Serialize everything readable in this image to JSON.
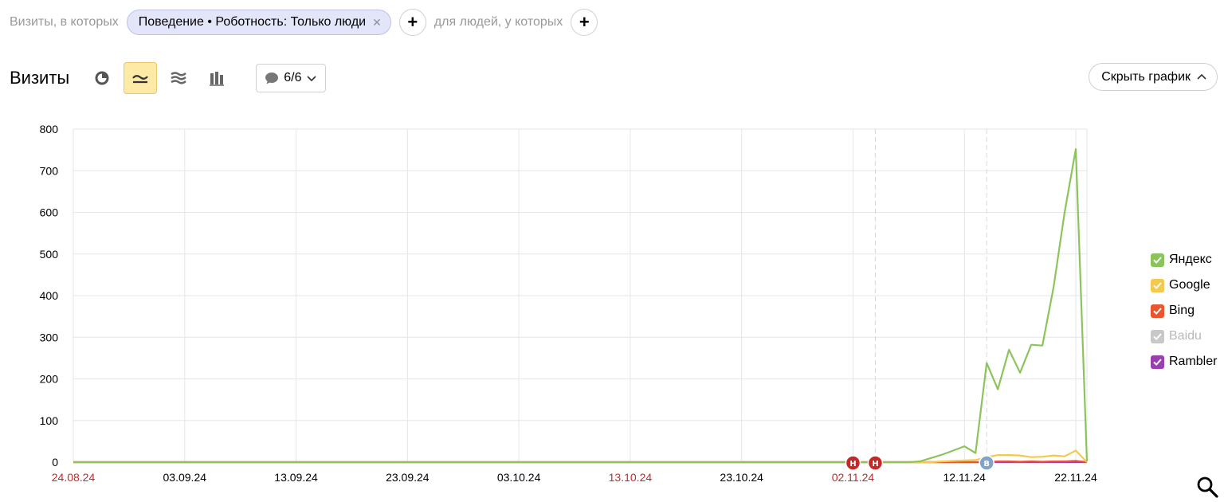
{
  "filters": {
    "prefix": "Визиты, в которых",
    "chip_label": "Поведение • Роботность: Только люди",
    "middle": "для людей, у которых",
    "add_symbol": "+"
  },
  "toolbar": {
    "title": "Визиты",
    "notes_count": "6/6",
    "hide_chart": "Скрыть график"
  },
  "chart_data": {
    "type": "line",
    "title": "",
    "xlabel": "",
    "ylabel": "",
    "ylim": [
      0,
      800
    ],
    "yticks": [
      0,
      100,
      200,
      300,
      400,
      500,
      600,
      700,
      800
    ],
    "x_start": "24.08.24",
    "x_end": "22.11.24",
    "num_days": 91,
    "grid": true,
    "legend_position": "right",
    "xticks": [
      {
        "label": "24.08.24",
        "day": 0,
        "holiday": true
      },
      {
        "label": "03.09.24",
        "day": 10,
        "holiday": false
      },
      {
        "label": "13.09.24",
        "day": 20,
        "holiday": false
      },
      {
        "label": "23.09.24",
        "day": 30,
        "holiday": false
      },
      {
        "label": "03.10.24",
        "day": 40,
        "holiday": false
      },
      {
        "label": "13.10.24",
        "day": 50,
        "holiday": true
      },
      {
        "label": "23.10.24",
        "day": 60,
        "holiday": false
      },
      {
        "label": "02.11.24",
        "day": 70,
        "holiday": true
      },
      {
        "label": "12.11.24",
        "day": 80,
        "holiday": false
      },
      {
        "label": "22.11.24",
        "day": 90,
        "holiday": false
      }
    ],
    "annotations": [
      {
        "day": 70,
        "label": "Н",
        "color": "#c62828"
      },
      {
        "day": 72,
        "label": "Н",
        "color": "#c62828"
      },
      {
        "day": 82,
        "label": "В",
        "color": "#7fa3c9"
      }
    ],
    "dashed_lines": [
      72,
      82
    ],
    "series": [
      {
        "name": "Яндекс",
        "color": "#8cc45c",
        "points": [
          [
            0,
            0
          ],
          [
            75,
            0
          ],
          [
            76,
            2
          ],
          [
            77,
            10
          ],
          [
            78,
            18
          ],
          [
            79,
            28
          ],
          [
            80,
            38
          ],
          [
            81,
            22
          ],
          [
            82,
            238
          ],
          [
            83,
            175
          ],
          [
            84,
            270
          ],
          [
            85,
            215
          ],
          [
            86,
            282
          ],
          [
            87,
            280
          ],
          [
            88,
            420
          ],
          [
            89,
            600
          ],
          [
            90,
            752
          ],
          [
            91,
            2
          ]
        ]
      },
      {
        "name": "Google",
        "color": "#f4c94e",
        "points": [
          [
            0,
            0
          ],
          [
            77,
            0
          ],
          [
            78,
            2
          ],
          [
            79,
            3
          ],
          [
            80,
            4
          ],
          [
            81,
            5
          ],
          [
            82,
            12
          ],
          [
            83,
            17
          ],
          [
            84,
            17
          ],
          [
            85,
            16
          ],
          [
            86,
            12
          ],
          [
            87,
            13
          ],
          [
            88,
            16
          ],
          [
            89,
            14
          ],
          [
            90,
            28
          ],
          [
            91,
            0
          ]
        ]
      },
      {
        "name": "Bing",
        "color": "#e8552f",
        "points": [
          [
            0,
            0
          ],
          [
            82,
            0
          ],
          [
            83,
            2
          ],
          [
            84,
            2
          ],
          [
            85,
            1
          ],
          [
            86,
            2
          ],
          [
            87,
            1
          ],
          [
            88,
            2
          ],
          [
            89,
            2
          ],
          [
            90,
            3
          ],
          [
            91,
            0
          ]
        ]
      },
      {
        "name": "Baidu",
        "color": "#c8c8c8",
        "disabled": true,
        "points": [
          [
            0,
            0
          ],
          [
            91,
            0
          ]
        ]
      },
      {
        "name": "Rambler",
        "color": "#9b3fb0",
        "points": [
          [
            0,
            0
          ],
          [
            91,
            0
          ]
        ]
      }
    ]
  }
}
